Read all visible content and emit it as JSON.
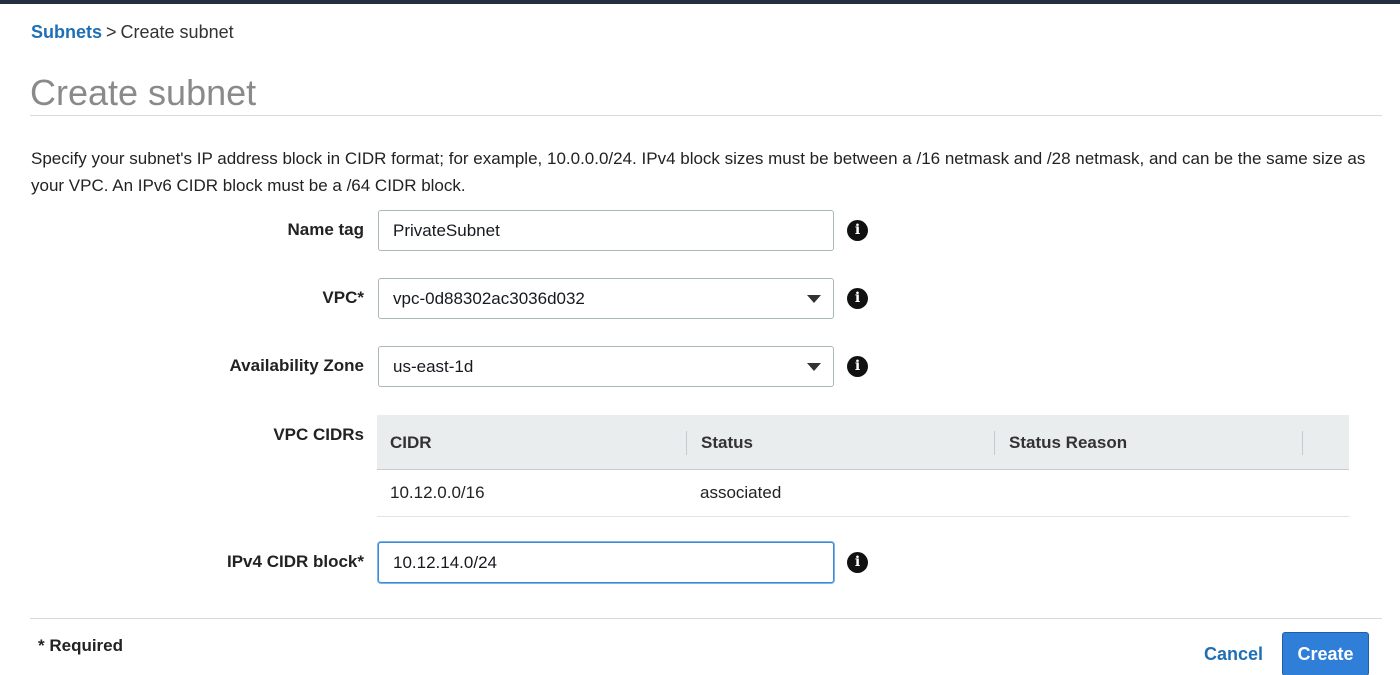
{
  "breadcrumb": {
    "parent": "Subnets",
    "separator": ">",
    "current": "Create subnet"
  },
  "page": {
    "title": "Create subnet",
    "description": "Specify your subnet's IP address block in CIDR format; for example, 10.0.0.0/24. IPv4 block sizes must be between a /16 netmask and /28 netmask, and can be the same size as your VPC. An IPv6 CIDR block must be a /64 CIDR block."
  },
  "form": {
    "name_tag": {
      "label": "Name tag",
      "value": "PrivateSubnet"
    },
    "vpc": {
      "label": "VPC*",
      "value": "vpc-0d88302ac3036d032"
    },
    "availability_zone": {
      "label": "Availability Zone",
      "value": "us-east-1d"
    },
    "vpc_cidrs": {
      "label": "VPC CIDRs",
      "columns": [
        "CIDR",
        "Status",
        "Status Reason"
      ],
      "rows": [
        {
          "cidr": "10.12.0.0/16",
          "status": "associated",
          "status_reason": ""
        }
      ]
    },
    "ipv4_cidr_block": {
      "label": "IPv4 CIDR block*",
      "value": "10.12.14.0/24"
    }
  },
  "icons": {
    "info": "info-icon",
    "select": "chevron-down-icon"
  },
  "footer": {
    "required_note": "* Required",
    "cancel_label": "Cancel",
    "create_label": "Create"
  },
  "colors": {
    "link": "#1f6fb5",
    "primary_button": "#2f7ed8",
    "focus": "#3b8ad9"
  }
}
